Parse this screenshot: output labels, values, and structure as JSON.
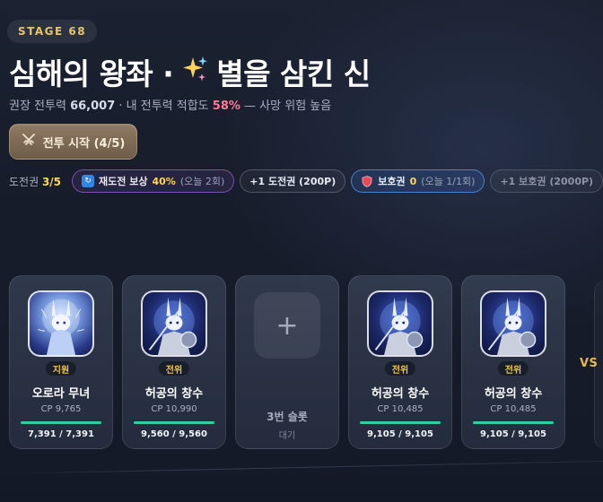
{
  "stage": {
    "badge": "STAGE 68"
  },
  "header": {
    "title_left": "심해의 왕좌 ·",
    "title_icon": "sparkles-icon",
    "title_right": "별을 삼킨 신",
    "sub_prefix": "권장 전투력",
    "recommended_power": "66,007",
    "sub_mid": "· 내 전투력 적합도",
    "fitness_pct": "58%",
    "sub_suffix": "— 사망 위험 높음"
  },
  "battle_button": {
    "label": "전투 시작 (4/5)",
    "icon": "crossed-swords-icon"
  },
  "tickets": {
    "label": "도전권",
    "value": "3/5",
    "retry_bonus": {
      "label": "재도전 보상",
      "value": "40%",
      "note": "(오늘 2회)"
    },
    "buy_ticket": "+1 도전권 (200P)",
    "shield": {
      "label": "보호권",
      "value": "0",
      "note": "(오늘 1/1회)"
    },
    "buy_shield": "+1 보호권 (2000P)"
  },
  "slots": [
    {
      "role": "지원",
      "name": "오로라 무녀",
      "cp": "CP 9,765",
      "hp": "7,391 / 7,391",
      "hp_ratio": 1.0
    },
    {
      "role": "전위",
      "name": "허공의 창수",
      "cp": "CP 10,990",
      "hp": "9,560 / 9,560",
      "hp_ratio": 1.0
    },
    {
      "empty_label": "3번 슬롯",
      "empty_sub": "대기",
      "plus": "+"
    },
    {
      "role": "전위",
      "name": "허공의 창수",
      "cp": "CP 10,485",
      "hp": "9,105 / 9,105",
      "hp_ratio": 1.0
    },
    {
      "role": "전위",
      "name": "허공의 창수",
      "cp": "CP 10,485",
      "hp": "9,105 / 9,105",
      "hp_ratio": 1.0
    }
  ],
  "vs_label": "VS",
  "colors": {
    "accent_gold": "#e8c46a",
    "danger_pink": "#ff7a95",
    "hp_green": "#2fd0a0"
  }
}
